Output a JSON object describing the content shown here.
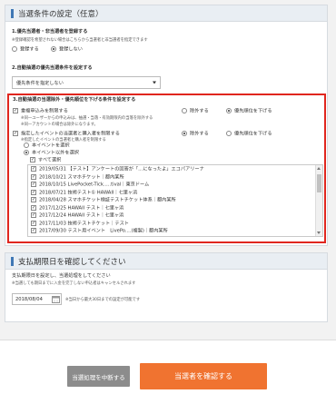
{
  "section1": {
    "title": "当選条件の設定（任意）",
    "q1": {
      "heading": "1.優先当選者・非当選者を登録する",
      "note": "※登録確認を希望されない場合はこちらから当選者と非当選者を指定できます",
      "options": [
        "登録する",
        "登録しない"
      ],
      "selected_index": 1
    },
    "q2": {
      "heading": "2.自動抽選の優先当選条件を設定する",
      "select_value": "優先条件を指定しない"
    },
    "q3": {
      "heading": "3.自動抽選の当選除外・優先順位を下げる条件を設定する",
      "row1": {
        "label": "重複申込みを制限する",
        "notes": [
          "※同一ユーザーからの申込みは、抽選・当落・有効期限内の当落を除外する",
          "※同一アカウントの場合は除外になります。"
        ],
        "options": [
          "除外する",
          "優先順位を下げる"
        ],
        "selected_index": 1
      },
      "row2": {
        "label": "指定したイベントの当選者と購入者を制限する",
        "notes": [
          "※指定したイベントの当選者と購入者を制限する"
        ],
        "options": [
          "除外する",
          "優先順位を下げる"
        ],
        "selected_index": 0
      },
      "sub_options": [
        "本イベントを選択",
        "本イベント以外を選択"
      ],
      "select_all": "すべて選択",
      "events": [
        "2019/05/31 【テスト】アンケートの回答が「…になったよ」エコパアリーナ",
        "2018/10/21 スマホチケット｜都内某所",
        "2018/10/15 LivePocket-Tick.....tival｜東京ドーム",
        "2018/07/21 技術テスト① HAWAII｜七里ヶ浜",
        "2018/04/28 スマホチケット検証テストチケット体系｜都内某所",
        "2017/12/25 HAWAII テスト｜七里ヶ浜",
        "2017/12/24 HAWAII テスト｜七里ヶ浜",
        "2017/11/03 技術テストチケット｜テスト",
        "2017/09/30 テスト用イベント　LivePo....(複製)｜都内某所"
      ]
    }
  },
  "section2": {
    "title": "支払期限日を確認してください",
    "line1": "支払期限日を設定し、当選処理をしてください",
    "line2": "※当選しても期日までに入金を完了しない申込者はキャンセルされます",
    "date_value": "2018/08/04",
    "date_note": "※当日から最大30日までの設定が可能です"
  },
  "footer": {
    "cancel_label": "当選処理を中断する",
    "confirm_label": "当選者を確認する"
  },
  "colors": {
    "accent_blue": "#3f78b5",
    "highlight_red": "#e0261e",
    "primary_orange": "#f07330",
    "secondary_gray": "#8c8c8c"
  }
}
